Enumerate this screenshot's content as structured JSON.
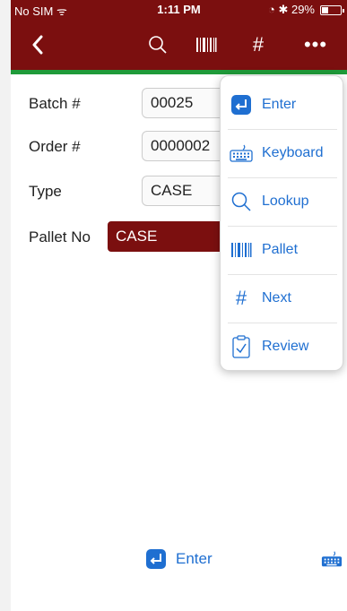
{
  "status_bar": {
    "carrier": "No SIM",
    "time": "1:11 PM",
    "battery": "29%"
  },
  "form": {
    "batch_label": "Batch #",
    "batch_value": "00025",
    "order_label": "Order #",
    "order_value": "0000002",
    "type_label": "Type",
    "type_value": "CASE",
    "pallet_label": "Pallet No",
    "pallet_value": "CASE"
  },
  "menu": {
    "items": [
      {
        "label": "Enter",
        "icon": "enter-icon"
      },
      {
        "label": "Keyboard",
        "icon": "keyboard-icon"
      },
      {
        "label": "Lookup",
        "icon": "search-icon"
      },
      {
        "label": "Pallet",
        "icon": "barcode-icon"
      },
      {
        "label": "Next",
        "icon": "hash-icon"
      },
      {
        "label": "Review",
        "icon": "review-icon"
      }
    ]
  },
  "bottom": {
    "enter_label": "Enter"
  },
  "colors": {
    "brand": "#7b0f0f",
    "accent": "#1f6fd1",
    "green": "#1f9b3a"
  }
}
